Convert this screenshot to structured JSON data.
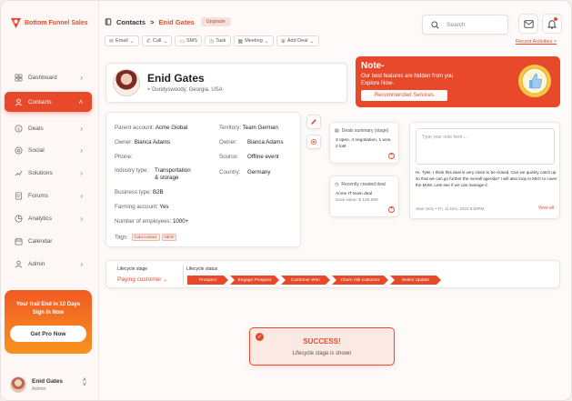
{
  "app": {
    "brand": "Bottom Funnel Sales"
  },
  "sidebar": {
    "items": [
      {
        "label": "Dashboard",
        "icon": "dashboard-icon"
      },
      {
        "label": "Contacts",
        "icon": "contacts-icon",
        "active": true
      },
      {
        "label": "Deals",
        "icon": "deals-icon"
      },
      {
        "label": "Social",
        "icon": "social-icon"
      },
      {
        "label": "Solutions",
        "icon": "solutions-icon"
      },
      {
        "label": "Forums",
        "icon": "forums-icon"
      },
      {
        "label": "Analytics",
        "icon": "analytics-icon"
      },
      {
        "label": "Calendar",
        "icon": "calendar-icon"
      },
      {
        "label": "Admin",
        "icon": "admin-icon"
      }
    ],
    "trial": {
      "line1": "Your trail End in 10 Days",
      "line2": "Sign In Now",
      "button": "Get Pro Now"
    },
    "user": {
      "name": "Enid Gates",
      "role": "Admin"
    }
  },
  "header": {
    "breadcrumb_root": "Contacts",
    "breadcrumb_sep": ">",
    "breadcrumb_current": "Enid Gates",
    "upgrade": "Upgrade",
    "search_placeholder": "Search"
  },
  "actions": [
    {
      "icon": "email-icon",
      "glyph": "✉",
      "label": "Email",
      "dropdown": true
    },
    {
      "icon": "call-icon",
      "glyph": "✆",
      "label": "Call",
      "dropdown": true
    },
    {
      "icon": "sms-icon",
      "glyph": "▭",
      "label": "SMS",
      "dropdown": false
    },
    {
      "icon": "task-icon",
      "glyph": "◷",
      "label": "Task",
      "dropdown": false
    },
    {
      "icon": "meeting-icon",
      "glyph": "▦",
      "label": "Meeting",
      "dropdown": true
    },
    {
      "icon": "add-deal-icon",
      "glyph": "⊕",
      "label": "Add Deal",
      "dropdown": true
    }
  ],
  "recent_activities": "Recent Activities >",
  "profile": {
    "name": "Enid Gates",
    "location": "Dundyswoody, Georgia, USA"
  },
  "note": {
    "title": "Note-",
    "line1": "Our best features are hidden from you",
    "line2": "Explore Now-",
    "button": "Recommended Services"
  },
  "details": {
    "parent_account": {
      "label": "Parent account:",
      "value": "Acme Global"
    },
    "owner1": {
      "label": "Owner:",
      "value": "Bianca Adams"
    },
    "phone": {
      "label": "Phone:",
      "value": ""
    },
    "industry": {
      "label": "Industry type:",
      "value1": "Transportation",
      "value2": "& storage"
    },
    "business": {
      "label": "Business type:",
      "value": "B2B"
    },
    "farming": {
      "label": "Farming account:",
      "value": "Yes"
    },
    "employees": {
      "label": "Number of employees:",
      "value": "1000+"
    },
    "tags": {
      "label": "Tags:",
      "items": [
        "Cold contact",
        "NEW"
      ]
    },
    "territory": {
      "label": "Territory:",
      "value": "Team German"
    },
    "owner2": {
      "label": "Owner:",
      "value": "Bianca Adams"
    },
    "source": {
      "label": "Source:",
      "value": "Offline event"
    },
    "country": {
      "label": "Country:",
      "value": "Germany"
    }
  },
  "deals_summary": {
    "title": "Deals summary (stage)",
    "line1": "3 open, 4 negotiation, 1 won,",
    "line2": "2 lost"
  },
  "recent_deal": {
    "title": "Recently created deal",
    "name": "Acme IT team deal",
    "value": "Deal value: $ 125,990"
  },
  "comment": {
    "placeholder": "Type your note here....",
    "text": "Hi, Tyler. I think this deal is very close to be closed. Can we quickly catch up so that we can go further the overall agenda? I will also loop in Mich to cover the MoM. Lets see if we can manage it.",
    "meta": "Stan Grey  •  Fri, 11 Dec, 2022  8:50PM",
    "view_all": "View all"
  },
  "lifecycle": {
    "stage_label": "Lifecycle stage",
    "stage_value": "Paying customer",
    "status_label": "Lifecycle status",
    "steps": [
      "Prospect",
      "Engage Prospect",
      "Customer Won",
      "Churn risk customer",
      "Select Update"
    ]
  },
  "success": {
    "title": "SUCCESS!",
    "text": "Lifecycle stage is shown"
  },
  "colors": {
    "accent": "#e8492b",
    "trial_gradient_start": "#f15a24",
    "trial_gradient_end": "#f7931e"
  }
}
